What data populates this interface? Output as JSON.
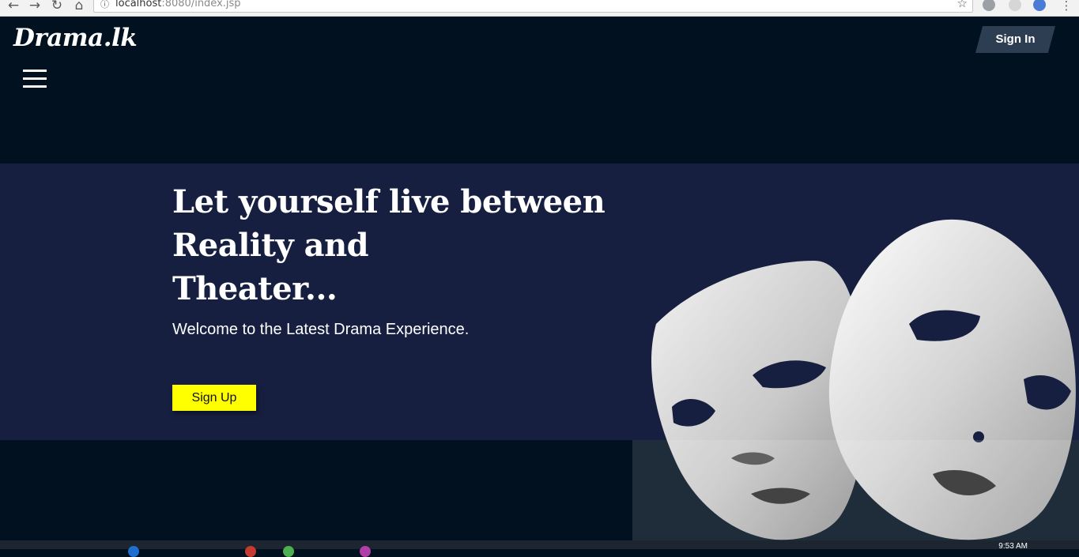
{
  "browser": {
    "back_icon": "back-arrow-icon",
    "forward_icon": "forward-arrow-icon",
    "reload_icon": "reload-icon",
    "home_icon": "home-icon",
    "url_host": "localhost",
    "url_port_path": ":8080/index.jsp",
    "bookmark_icon": "star-icon"
  },
  "header": {
    "logo": "Drama.lk",
    "sign_in_label": "Sign In",
    "menu_icon": "hamburger-menu-icon"
  },
  "hero": {
    "title_lines": [
      "Let yourself live between",
      "Reality and",
      "Theater..."
    ],
    "subtitle": "Welcome to the Latest Drama Experience.",
    "sign_up_label": "Sign Up",
    "image": "theater-masks"
  },
  "taskbar": {
    "clock": "9:53 AM"
  },
  "colors": {
    "page_background": "#01111f",
    "hero_background": "#171f41",
    "sign_in_background": "#2d3e52",
    "sign_up_background": "#ffff00"
  }
}
